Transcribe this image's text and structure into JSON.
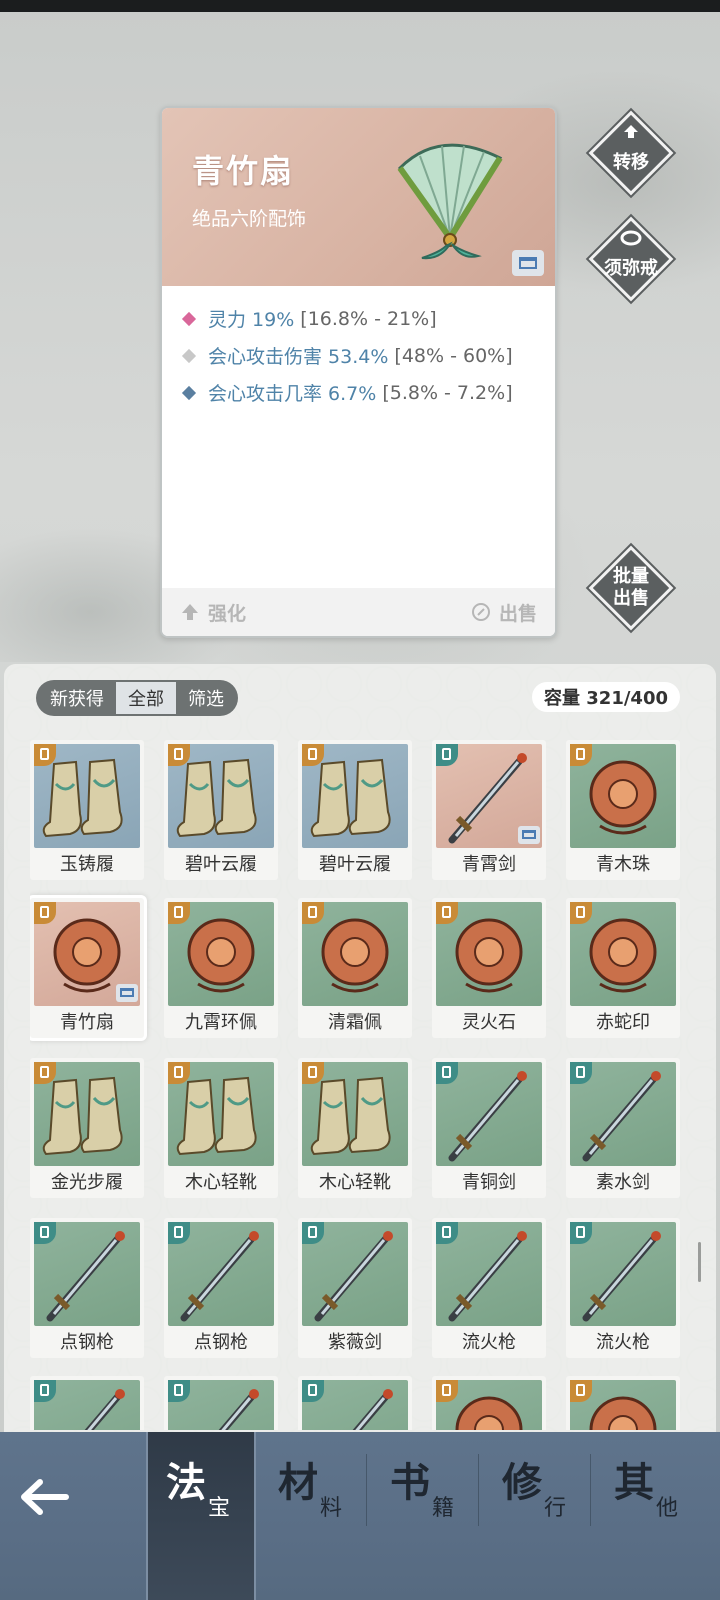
{
  "detail": {
    "name": "青竹扇",
    "subtitle": "绝品六阶配饰",
    "stats": [
      {
        "label": "灵力 19%",
        "range": "[16.8% - 21%]",
        "color": "#d9679a"
      },
      {
        "label": "会心攻击伤害 53.4%",
        "range": "[48% - 60%]",
        "color": "#c8c8c8"
      },
      {
        "label": "会心攻击几率 6.7%",
        "range": "[5.8% - 7.2%]",
        "color": "#5a7fa0"
      }
    ],
    "enhance_label": "强化",
    "sell_label": "出售"
  },
  "side": {
    "transfer_label": "转移",
    "ring_label": "须弥戒",
    "batch_sell_line1": "批量",
    "batch_sell_line2": "出售"
  },
  "inventory": {
    "filters": [
      "新获得",
      "全部",
      "筛选"
    ],
    "active_filter": "全部",
    "capacity": "容量 321/400",
    "items": [
      {
        "name": "玉铸履",
        "bg": "blue",
        "type": "boots"
      },
      {
        "name": "碧叶云履",
        "bg": "blue",
        "type": "boots"
      },
      {
        "name": "碧叶云履",
        "bg": "blue",
        "type": "boots"
      },
      {
        "name": "青霄剑",
        "bg": "pink",
        "type": "weapon",
        "tagged": true
      },
      {
        "name": "青木珠",
        "bg": "green",
        "type": "accessory"
      },
      {
        "name": "青竹扇",
        "bg": "pink",
        "type": "accessory",
        "tagged": true,
        "selected": true
      },
      {
        "name": "九霄环佩",
        "bg": "green",
        "type": "accessory"
      },
      {
        "name": "清霜佩",
        "bg": "green",
        "type": "accessory"
      },
      {
        "name": "灵火石",
        "bg": "green",
        "type": "accessory"
      },
      {
        "name": "赤蛇印",
        "bg": "green",
        "type": "accessory"
      },
      {
        "name": "金光步履",
        "bg": "green",
        "type": "boots"
      },
      {
        "name": "木心轻靴",
        "bg": "green",
        "type": "boots"
      },
      {
        "name": "木心轻靴",
        "bg": "green",
        "type": "boots"
      },
      {
        "name": "青铜剑",
        "bg": "green",
        "type": "weapon"
      },
      {
        "name": "素水剑",
        "bg": "green",
        "type": "weapon"
      },
      {
        "name": "点钢枪",
        "bg": "green",
        "type": "weapon"
      },
      {
        "name": "点钢枪",
        "bg": "green",
        "type": "weapon"
      },
      {
        "name": "紫薇剑",
        "bg": "green",
        "type": "weapon"
      },
      {
        "name": "流火枪",
        "bg": "green",
        "type": "weapon"
      },
      {
        "name": "流火枪",
        "bg": "green",
        "type": "weapon"
      },
      {
        "name": "",
        "bg": "green",
        "type": "weapon"
      },
      {
        "name": "",
        "bg": "green",
        "type": "weapon"
      },
      {
        "name": "",
        "bg": "green",
        "type": "weapon"
      },
      {
        "name": "",
        "bg": "green",
        "type": "accessory"
      },
      {
        "name": "",
        "bg": "green",
        "type": "accessory"
      }
    ]
  },
  "nav": {
    "tabs": [
      {
        "big": "法",
        "small": "宝",
        "active": true
      },
      {
        "big": "材",
        "small": "料"
      },
      {
        "big": "书",
        "small": "籍"
      },
      {
        "big": "修",
        "small": "行"
      },
      {
        "big": "其",
        "small": "他"
      }
    ]
  }
}
